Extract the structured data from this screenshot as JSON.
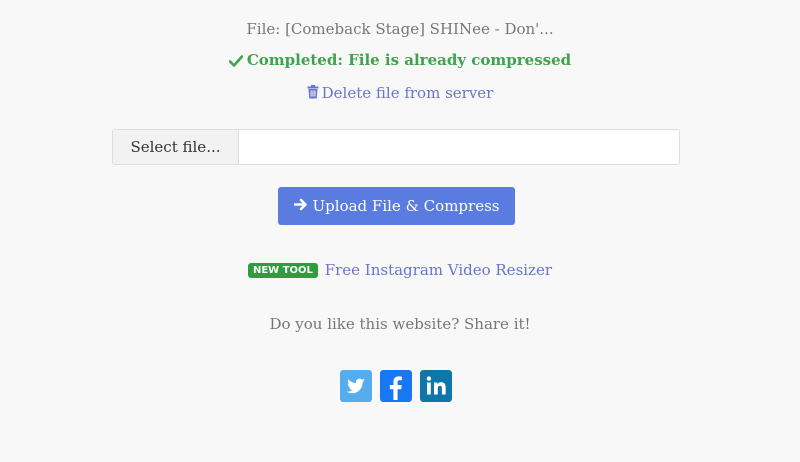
{
  "file": {
    "label": "File: [Comeback Stage] SHINee - Don'..."
  },
  "status": {
    "text": "Completed: File is already compressed",
    "icon": "check-icon",
    "color": "#3fa34d"
  },
  "delete": {
    "label": "Delete file from server",
    "icon": "trash-icon"
  },
  "file_input": {
    "button_label": "Select file...",
    "value": ""
  },
  "upload": {
    "label": "Upload File & Compress",
    "icon": "arrow-right-icon",
    "color": "#5a7be0"
  },
  "promo": {
    "badge": "NEW TOOL",
    "link": "Free Instagram Video Resizer",
    "badge_color": "#2e9c3f"
  },
  "share": {
    "text": "Do you like this website? Share it!",
    "networks": [
      {
        "name": "twitter-icon",
        "color": "#55acee"
      },
      {
        "name": "facebook-icon",
        "color": "#1877f2"
      },
      {
        "name": "linkedin-icon",
        "color": "#0e76a8"
      }
    ]
  }
}
